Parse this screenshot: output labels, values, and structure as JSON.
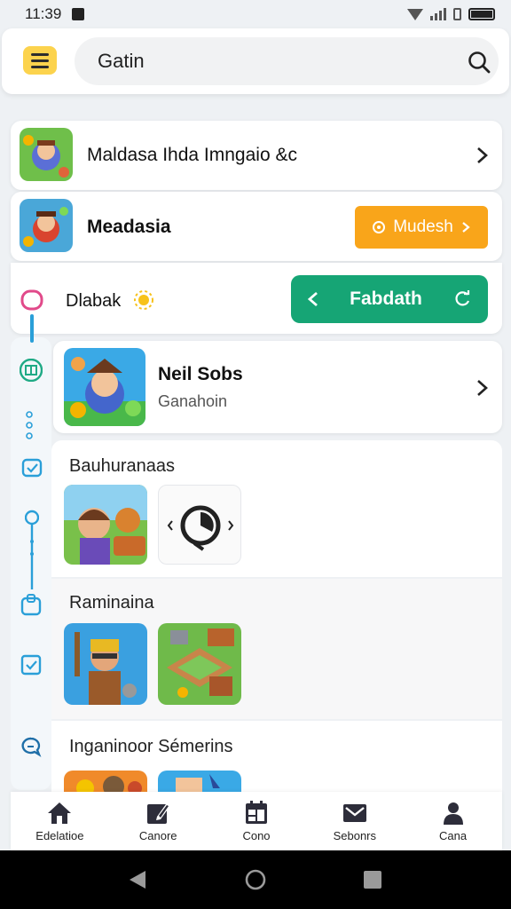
{
  "status_bar": {
    "time": "11:39"
  },
  "search": {
    "value": "Gatin"
  },
  "list": [
    {
      "title": "Maldasa Ihda Imngaio &c"
    },
    {
      "title": "Meadasia",
      "button": "Mudesh"
    },
    {
      "title": "Dlabak",
      "button": "Fabdath"
    },
    {
      "title": "Neil Sobs",
      "subtitle": "Ganahoin"
    }
  ],
  "sections": [
    {
      "title": "Bauhuranaas"
    },
    {
      "title": "Raminaina"
    },
    {
      "title": "Inganinoor Sémerins"
    }
  ],
  "bottom_nav": [
    {
      "label": "Edelatioe",
      "icon": "home-icon"
    },
    {
      "label": "Canore",
      "icon": "edit-icon"
    },
    {
      "label": "Cono",
      "icon": "calendar-icon"
    },
    {
      "label": "Sebonrs",
      "icon": "mail-icon"
    },
    {
      "label": "Cana",
      "icon": "profile-icon"
    }
  ],
  "colors": {
    "accent_orange": "#f9a51a",
    "accent_green": "#16a575",
    "menu_yellow": "#fcd34d",
    "rail_blue": "#2a9fd8"
  }
}
